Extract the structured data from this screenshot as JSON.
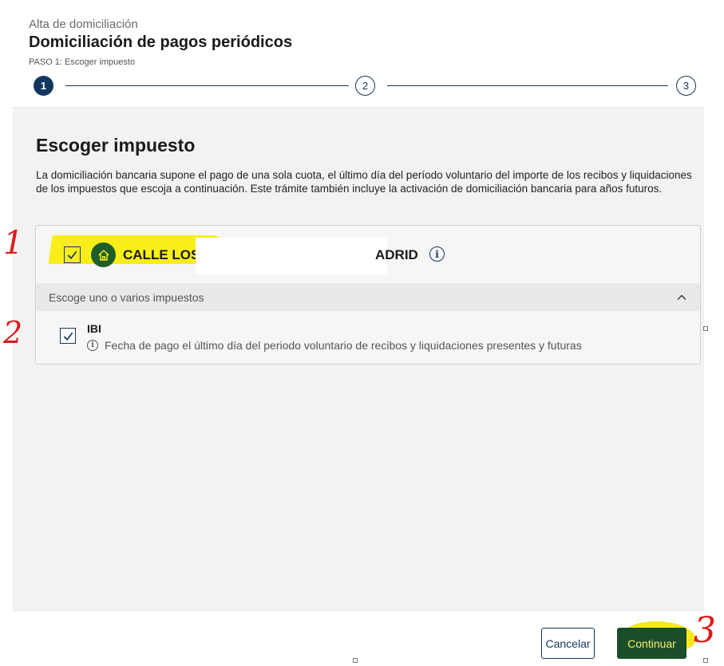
{
  "header": {
    "kicker": "Alta de domiciliación",
    "title": "Domiciliación de pagos periódicos",
    "step_label": "PASO 1: Escoger impuesto",
    "steps": [
      {
        "number": "1",
        "state": "active"
      },
      {
        "number": "2",
        "state": "pending"
      },
      {
        "number": "3",
        "state": "pending"
      }
    ]
  },
  "section": {
    "title": "Escoger impuesto",
    "description": "La domiciliación bancaria supone el pago de una sola cuota, el último día del período voluntario del importe de los recibos y liquidaciones de los impuestos que escoja a continuación. Este trámite también incluye la activación de domiciliación bancaria para años futuros."
  },
  "property": {
    "address_left": "CALLE LOS",
    "address_right": "ADRID",
    "checked": true,
    "icon": "home-icon",
    "info_icon": "info-icon"
  },
  "taxes": {
    "header": "Escoge uno o varios impuestos",
    "items": [
      {
        "name": "IBI",
        "info": "Fecha de pago el último día del periodo voluntario de recibos y liquidaciones presentes y futuras",
        "checked": true
      }
    ]
  },
  "footer": {
    "cancel_label": "Cancelar",
    "continue_label": "Continuar"
  },
  "annotations": {
    "one": "1",
    "two": "2",
    "three": "3"
  },
  "colors": {
    "primary": "#13365f",
    "accent_green": "#1a4e2a",
    "highlight": "#f9ee1a",
    "annotation_red": "#e01919"
  }
}
